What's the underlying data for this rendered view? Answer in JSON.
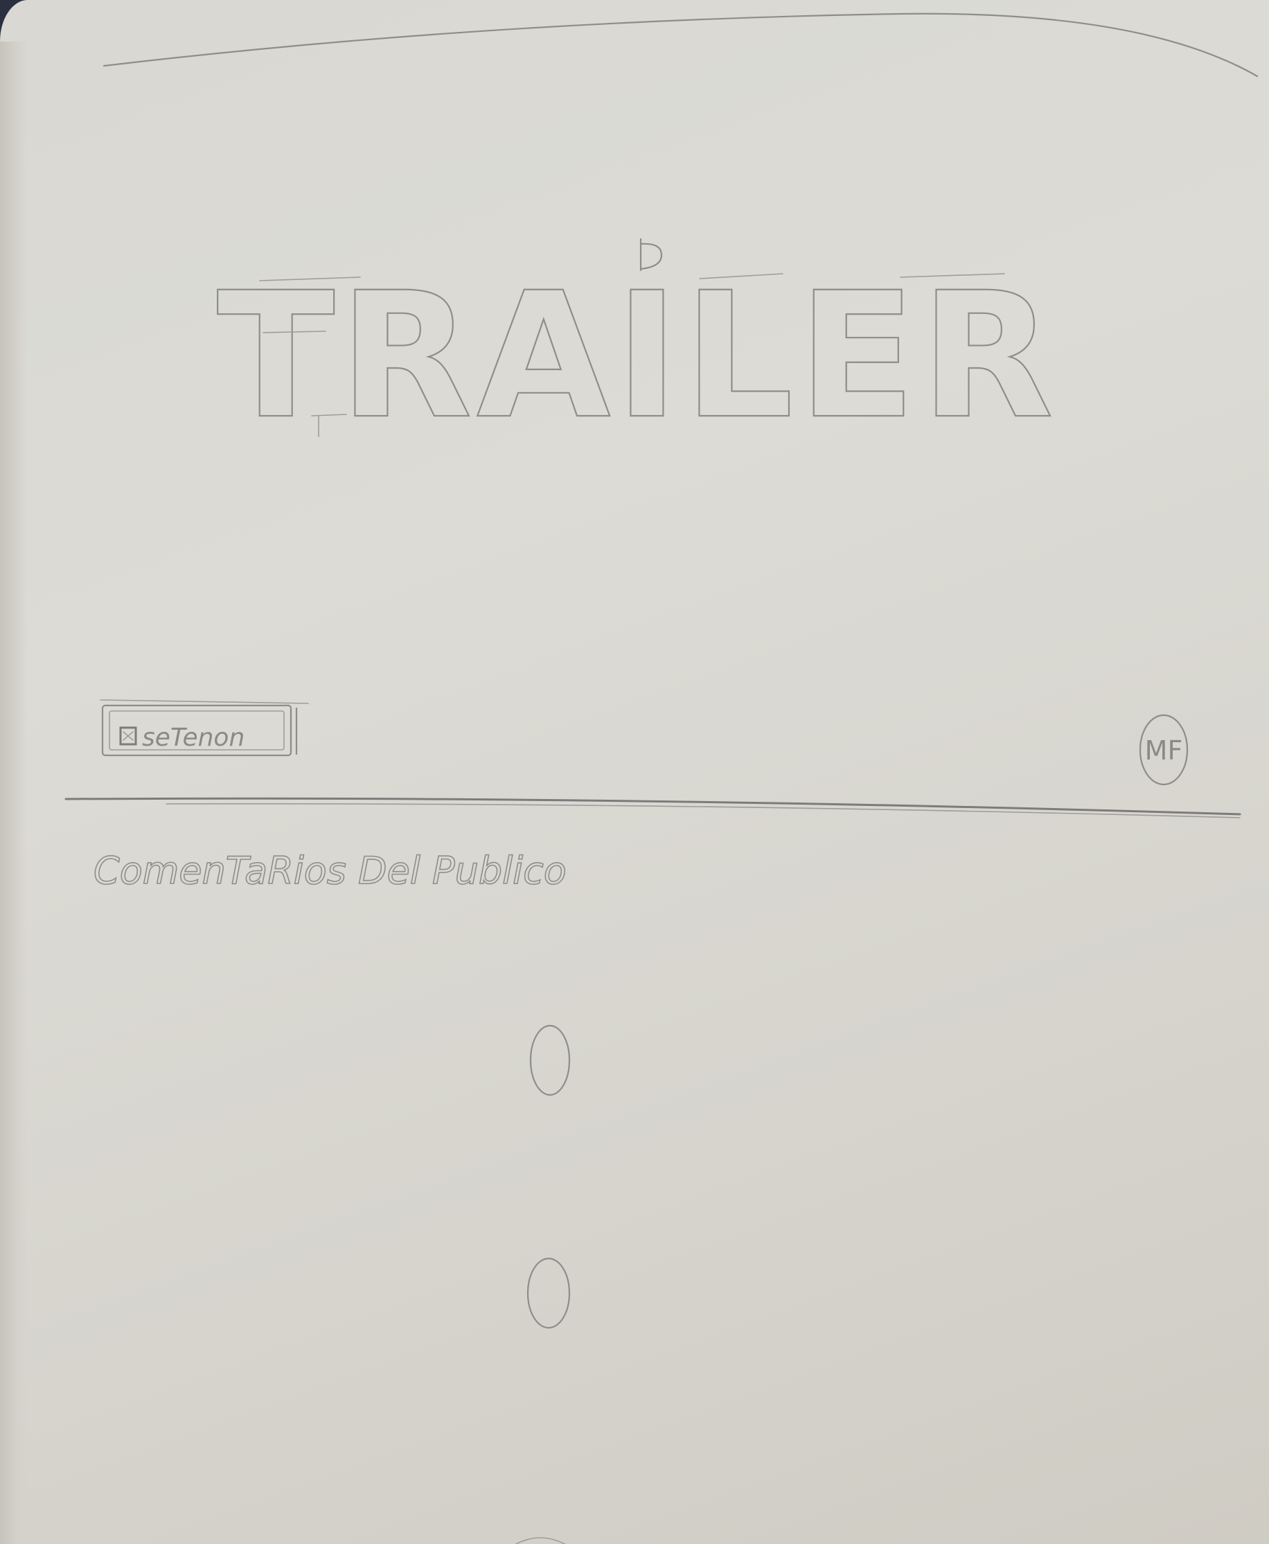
{
  "hero": {
    "title": "TRAILER"
  },
  "toolbar": {
    "button_label": "seTenon",
    "button_icon": "square-icon",
    "avatar_text": "MF"
  },
  "comments": {
    "heading": "ComenTaRios Del Publico",
    "items": [
      {
        "marker": "0"
      },
      {
        "marker": "0"
      }
    ]
  },
  "colors": {
    "paper": "#dad9d3",
    "pencil": "#8d8d8b"
  }
}
